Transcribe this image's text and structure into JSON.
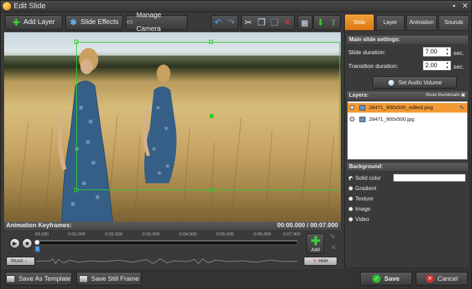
{
  "window": {
    "title": "Edit Slide"
  },
  "toolbar": {
    "add_layer": "Add Layer",
    "slide_effects": "Slide Effects",
    "manage_camera": "Manage Camera"
  },
  "tabs": [
    {
      "label": "Slide"
    },
    {
      "label": "Layer"
    },
    {
      "label": "Animation"
    },
    {
      "label": "Sounds"
    }
  ],
  "main_settings": {
    "header": "Main slide settings:",
    "slide_duration_label": "Slide duration:",
    "slide_duration_value": "7.00",
    "transition_duration_label": "Transition duration:",
    "transition_duration_value": "2.00",
    "unit": "sec.",
    "set_audio_volume": "Set Audio Volume"
  },
  "layers": {
    "header": "Layers:",
    "show_thumbnails": "Show thumbnails",
    "items": [
      {
        "name": "28471_900x500_edited.png",
        "selected": true
      },
      {
        "name": "28471_900x500.jpg",
        "selected": false
      }
    ]
  },
  "background": {
    "header": "Background:",
    "options": [
      {
        "label": "Solid color",
        "selected": true
      },
      {
        "label": "Gradient",
        "selected": false
      },
      {
        "label": "Texture",
        "selected": false
      },
      {
        "label": "Image",
        "selected": false
      },
      {
        "label": "Video",
        "selected": false
      }
    ],
    "solid_color": "#ffffff"
  },
  "keyframes": {
    "header": "Animation Keyframes:",
    "time_range": "00:00.000 / 00:07.000",
    "ticks": [
      "00.000",
      "0:01.000",
      "0:02.000",
      "0:03.000",
      "0:04.000",
      "0:05.000",
      "0:06.000",
      "0:07.000"
    ],
    "add_label": "Add",
    "music_label": "Music",
    "hide_label": "Hide",
    "marker_number": "1"
  },
  "bottom": {
    "save_template": "Save As Template",
    "save_still": "Save Still Frame",
    "save": "Save",
    "cancel": "Cancel"
  },
  "colors": {
    "accent": "#e8861e",
    "selection": "#2bd12b"
  }
}
